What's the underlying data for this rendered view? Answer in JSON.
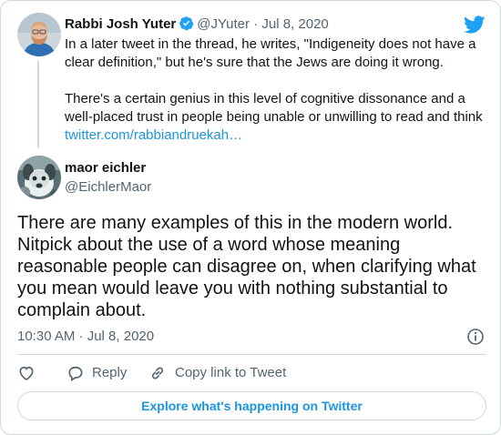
{
  "quoted_tweet": {
    "name": "Rabbi Josh Yuter",
    "handle": "@JYuter",
    "separator": "·",
    "date": "Jul 8, 2020",
    "text_p1": "In a later tweet in the thread, he writes, \"Indigeneity does not have a clear definition,\" but he's sure that the Jews are doing it wrong.",
    "text_p2": "There's a certain genius in this level of cognitive dissonance and a well-placed trust in people being unable or unwilling to read and think",
    "link": "twitter.com/rabbiandruekah…"
  },
  "main_tweet": {
    "name": "maor eichler",
    "handle": "@EichlerMaor",
    "text": "There are many examples of this in the modern world. Nitpick about the use of a word whose meaning reasonable people can disagree on, when clarifying what you mean would leave you with nothing substantial to complain about.",
    "timestamp": "10:30 AM · Jul 8, 2020"
  },
  "actions": {
    "reply": "Reply",
    "copy_link": "Copy link to Tweet"
  },
  "explore_label": "Explore what's happening on Twitter",
  "colors": {
    "twitter_blue": "#1da1f2",
    "link_blue": "#1b95e0",
    "muted_text": "#536471",
    "border": "#cfd9de"
  },
  "icons": {
    "brand": "twitter-bird-icon",
    "verified": "verified-badge-icon",
    "info": "info-icon",
    "like": "heart-icon",
    "reply": "reply-bubble-icon",
    "copy_link": "link-icon"
  }
}
